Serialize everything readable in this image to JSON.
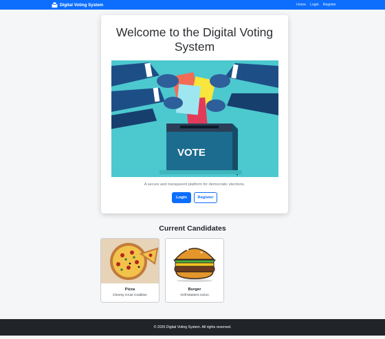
{
  "navbar": {
    "brand": "Digital Voting System",
    "brand_icon": "ballot-box-icon",
    "links": [
      "Home",
      "Login",
      "Register"
    ]
  },
  "hero": {
    "title": "Welcome to the Digital Voting System",
    "illustration_text": "VOTE",
    "tagline": "A secure and transparent platform for democratic elections.",
    "login_label": "Login",
    "register_label": "Register"
  },
  "candidates": {
    "title": "Current Candidates",
    "items": [
      {
        "name": "Pizza",
        "party": "Cheesy Crust Coalition",
        "image": "pizza-image"
      },
      {
        "name": "Burger",
        "party": "Grill Masters Union",
        "image": "burger-image"
      }
    ]
  },
  "footer": {
    "text": "© 2025 Digital Voting System. All rights reserved."
  },
  "colors": {
    "primary": "#0d6efd",
    "footer_bg": "#212529",
    "illustration_bg": "#4cc8cf"
  }
}
